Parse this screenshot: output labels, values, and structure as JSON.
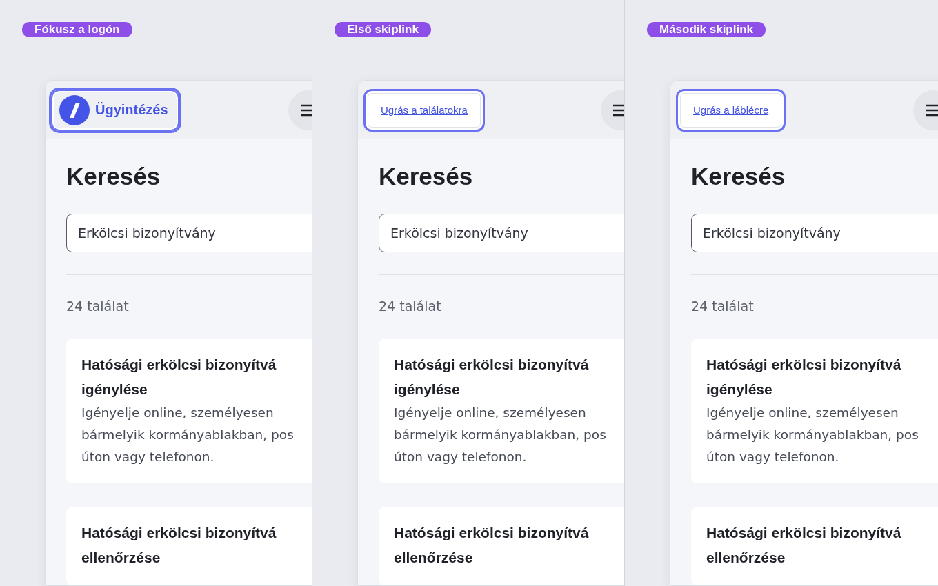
{
  "panels": [
    {
      "caption": "Fókusz a logón",
      "focus": {
        "kind": "logo",
        "label": "Ügyintézés"
      },
      "heading": "Keresés",
      "search": {
        "value": "Erkölcsi bizonyítvány"
      },
      "count": "24 találat",
      "results": [
        {
          "title": "Hatósági erkölcsi bizonyítvá\nigénylése",
          "description": "Igényelje online, személyesen\nbármelyik kormányablakban, pos\núton vagy telefonon."
        },
        {
          "title": "Hatósági erkölcsi bizonyítvá\nellenőrzése"
        }
      ]
    },
    {
      "caption": "Első skiplink",
      "focus": {
        "kind": "skiplink",
        "label": "Ugrás a találatokra"
      },
      "heading": "Keresés",
      "search": {
        "value": "Erkölcsi bizonyítvány"
      },
      "count": "24 találat",
      "results": [
        {
          "title": "Hatósági erkölcsi bizonyítvá\nigénylése",
          "description": "Igényelje online, személyesen\nbármelyik kormányablakban, pos\núton vagy telefonon."
        },
        {
          "title": "Hatósági erkölcsi bizonyítvá\nellenőrzése"
        }
      ]
    },
    {
      "caption": "Második skiplink",
      "focus": {
        "kind": "skiplink",
        "label": "Ugrás a láblécre"
      },
      "heading": "Keresés",
      "search": {
        "value": "Erkölcsi bizonyítvány"
      },
      "count": "24 találat",
      "results": [
        {
          "title": "Hatósági erkölcsi bizonyítvá\nigénylése",
          "description": "Igényelje online, személyesen\nbármelyik kormányablakban, pos\núton vagy telefonon."
        },
        {
          "title": "Hatósági erkölcsi bizonyítvá\nellenőrzése"
        }
      ]
    }
  ]
}
